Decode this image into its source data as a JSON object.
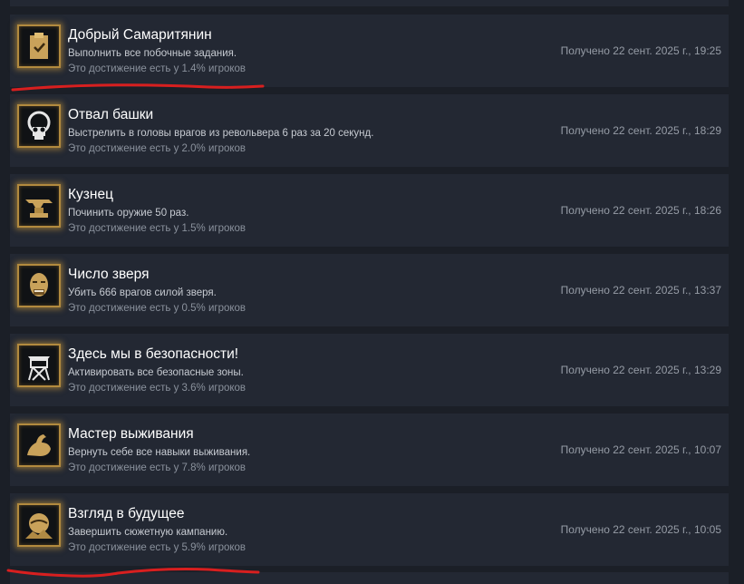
{
  "achievements": [
    {
      "title": "Добрый Самаритянин",
      "description": "Выполнить все побочные задания.",
      "rarity": "Это достижение есть у 1.4% игроков",
      "unlocked": "Получено 22 сент. 2025 г., 19:25",
      "icon": "clipboard-icon"
    },
    {
      "title": "Отвал башки",
      "description": "Выстрелить в головы врагов из револьвера 6 раз за 20 секунд.",
      "rarity": "Это достижение есть у 2.0% игроков",
      "unlocked": "Получено 22 сент. 2025 г., 18:29",
      "icon": "skull-icon"
    },
    {
      "title": "Кузнец",
      "description": "Починить оружие 50 раз.",
      "rarity": "Это достижение есть у 1.5% игроков",
      "unlocked": "Получено 22 сент. 2025 г., 18:26",
      "icon": "anvil-icon"
    },
    {
      "title": "Число зверя",
      "description": "Убить 666 врагов силой зверя.",
      "rarity": "Это достижение есть у 0.5% игроков",
      "unlocked": "Получено 22 сент. 2025 г., 13:37",
      "icon": "beast-face-icon"
    },
    {
      "title": "Здесь мы в безопасности!",
      "description": "Активировать все безопасные зоны.",
      "rarity": "Это достижение есть у 3.6% игроков",
      "unlocked": "Получено 22 сент. 2025 г., 13:29",
      "icon": "watchtower-icon"
    },
    {
      "title": "Мастер выживания",
      "description": "Вернуть себе все навыки выживания.",
      "rarity": "Это достижение есть у 7.8% игроков",
      "unlocked": "Получено 22 сент. 2025 г., 10:07",
      "icon": "flexed-arm-icon"
    },
    {
      "title": "Взгляд в будущее",
      "description": "Завершить сюжетную кампанию.",
      "rarity": "Это достижение есть у 5.9% игроков",
      "unlocked": "Получено 22 сент. 2025 г., 10:05",
      "icon": "horizon-icon"
    }
  ],
  "colors": {
    "background": "#1b1f27",
    "row": "#232833",
    "icon_border": "#b28a3e",
    "annotation": "#d81f1f"
  }
}
